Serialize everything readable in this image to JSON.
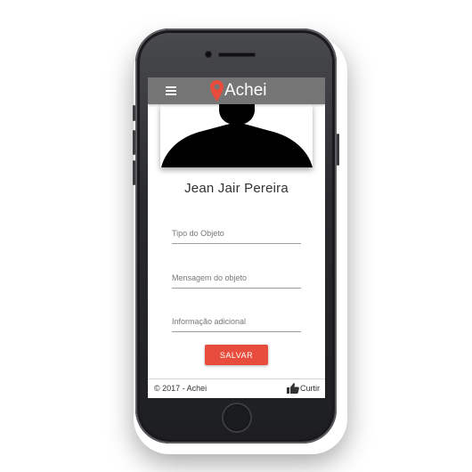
{
  "app": {
    "title": "Achei",
    "accent_color": "#e84c3d",
    "appbar_color": "#757575",
    "menu_icon": "hamburger-menu-icon",
    "logo_icon": "location-pin-icon"
  },
  "profile": {
    "avatar_icon": "person-silhouette-icon",
    "name": "Jean Jair Pereira"
  },
  "form": {
    "object_type_placeholder": "Tipo do Objeto",
    "object_message_placeholder": "Mensagem do objeto",
    "additional_info_placeholder": "Informação adicional",
    "save_label": "SALVAR"
  },
  "footer": {
    "copyright": "© 2017 - Achei",
    "like_icon": "thumbs-up-icon",
    "like_label": "Curtir"
  }
}
